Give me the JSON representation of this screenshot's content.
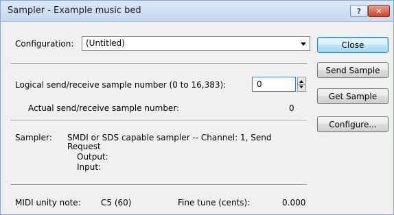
{
  "window": {
    "title": "Sampler - Example music bed"
  },
  "title_buttons": {
    "help": "?",
    "close": "✕"
  },
  "config": {
    "label": "Configuration:",
    "value": "(Untitled)"
  },
  "buttons": {
    "close": "Close",
    "send_sample": "Send Sample",
    "get_sample": "Get Sample",
    "configure": "Configure..."
  },
  "logical": {
    "label": "Logical send/receive sample number (0 to 16,383):",
    "value": "0"
  },
  "actual": {
    "label": "Actual send/receive sample number:",
    "value": "0"
  },
  "sampler": {
    "label": "Sampler:",
    "line1": "SMDI or SDS capable sampler -- Channel: 1, Send",
    "line2": "Request",
    "output_label": "Output:",
    "input_label": "Input:"
  },
  "midi": {
    "unity_label": "MIDI unity note:",
    "unity_value": "C5 (60)",
    "fine_label": "Fine tune (cents):",
    "fine_value": "0.000"
  }
}
